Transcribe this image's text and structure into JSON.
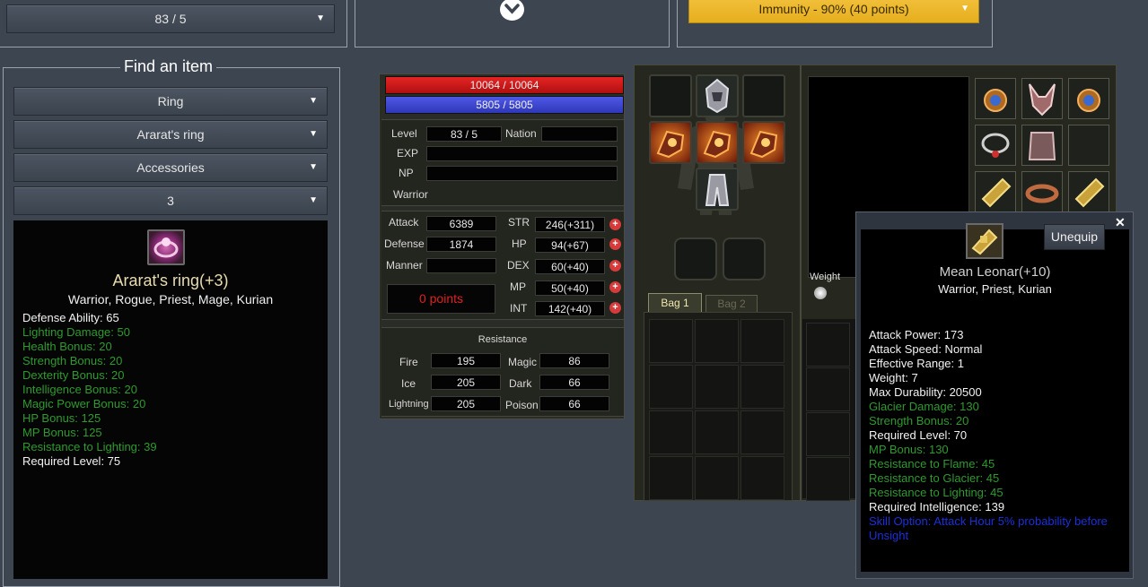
{
  "top": {
    "level_select": "83 / 5",
    "immunity_select": "Immunity - 90% (40 points)"
  },
  "find": {
    "legend": "Find an item",
    "selects": [
      "Ring",
      "Ararat's ring",
      "Accessories",
      "3"
    ],
    "item": {
      "name": "Ararat's ring(+3)",
      "classes": "Warrior, Rogue, Priest, Mage, Kurian",
      "stats": [
        {
          "text": "Defense Ability: 65",
          "color": "white"
        },
        {
          "text": "Lighting Damage: 50",
          "color": "green"
        },
        {
          "text": "Health Bonus: 20",
          "color": "green"
        },
        {
          "text": "Strength Bonus: 20",
          "color": "green"
        },
        {
          "text": "Dexterity Bonus: 20",
          "color": "green"
        },
        {
          "text": "Intelligence Bonus: 20",
          "color": "green"
        },
        {
          "text": "Magic Power Bonus: 20",
          "color": "green"
        },
        {
          "text": "HP Bonus: 125",
          "color": "green"
        },
        {
          "text": "MP Bonus: 125",
          "color": "green"
        },
        {
          "text": "Resistance to Lighting: 39",
          "color": "green"
        },
        {
          "text": "Required Level: 75",
          "color": "white"
        }
      ]
    }
  },
  "char": {
    "hp": "10064 / 10064",
    "mp": "5805 / 5805",
    "labels": {
      "level": "Level",
      "nation": "Nation",
      "exp": "EXP",
      "np": "NP"
    },
    "level": "83 / 5",
    "class": "Warrior",
    "stats": {
      "attack_label": "Attack",
      "attack": "6389",
      "defense_label": "Defense",
      "defense": "1874",
      "manner_label": "Manner",
      "points": "0 points",
      "str_label": "STR",
      "str": "246(+311)",
      "hp_label": "HP",
      "hp": "94(+67)",
      "dex_label": "DEX",
      "dex": "60(+40)",
      "mp_label": "MP",
      "mp": "50(+40)",
      "int_label": "INT",
      "int": "142(+40)"
    },
    "resistance": {
      "title": "Resistance",
      "fire_label": "Fire",
      "fire": "195",
      "magic_label": "Magic",
      "magic": "86",
      "ice_label": "Ice",
      "ice": "205",
      "dark_label": "Dark",
      "dark": "66",
      "lightning_label": "Lightning",
      "lightning": "205",
      "poison_label": "Poison",
      "poison": "66"
    }
  },
  "inventory": {
    "bag1": "Bag 1",
    "bag2": "Bag 2",
    "weight_label": "Weight"
  },
  "tooltip": {
    "close": "✕",
    "unequip": "Unequip",
    "name": "Mean Leonar(+10)",
    "classes": "Warrior, Priest, Kurian",
    "lines": [
      {
        "text": "Attack Power: 173",
        "color": "white"
      },
      {
        "text": "Attack Speed: Normal",
        "color": "white"
      },
      {
        "text": "Effective Range: 1",
        "color": "white"
      },
      {
        "text": "Weight: 7",
        "color": "white"
      },
      {
        "text": "Max Durability: 20500",
        "color": "white"
      },
      {
        "text": "Glacier Damage: 130",
        "color": "green"
      },
      {
        "text": "Strength Bonus: 20",
        "color": "green"
      },
      {
        "text": "Required Level: 70",
        "color": "white"
      },
      {
        "text": "MP Bonus: 130",
        "color": "green"
      },
      {
        "text": "Resistance to Flame: 45",
        "color": "green"
      },
      {
        "text": "Resistance to Glacier: 45",
        "color": "green"
      },
      {
        "text": "Resistance to Lighting: 45",
        "color": "green"
      },
      {
        "text": "Required Intelligence: 139",
        "color": "white"
      },
      {
        "text": "Skill Option: Attack Hour 5% probability before Unsight",
        "color": "blue"
      }
    ]
  },
  "icons": {
    "expand": "chevron-down-circle-icon",
    "plus": "plus-circle-icon"
  },
  "colors": {
    "green": "#2e9a2e",
    "blue": "#1c2fd8",
    "gold": "#f0bb34",
    "hp_bar": "#d21b1b",
    "mp_bar": "#3a45d6"
  }
}
